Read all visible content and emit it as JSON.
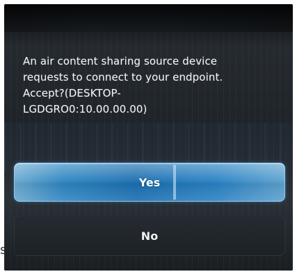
{
  "dialog": {
    "message": "An air content sharing source device\nrequests to connect to your endpoint.\nAccept?(DESKTOP-\nLGDGRO0:10.00.00.00)"
  },
  "buttons": {
    "yes_label": "Yes",
    "no_label": "No"
  },
  "colors": {
    "selected_button": "#2f86c2",
    "background": "#1e252b",
    "text": "#ffffff"
  }
}
